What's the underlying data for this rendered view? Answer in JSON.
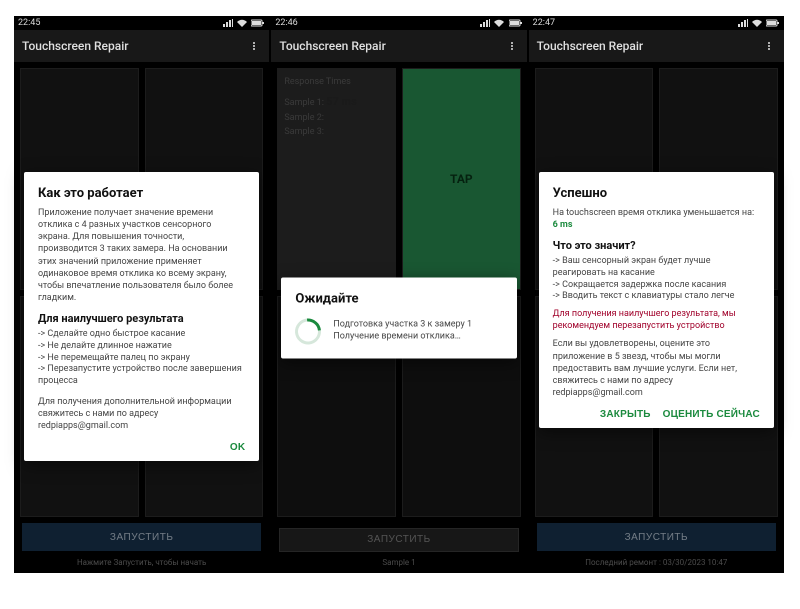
{
  "screens": [
    {
      "status_time": "22:45",
      "appbar_title": "Touchscreen Repair",
      "bottom_button": "ЗАПУСТИТЬ",
      "hint": "Нажмите Запустить, чтобы начать",
      "dialog": {
        "title": "Как это работает",
        "body": "Приложение получает значение времени отклика с 4 разных участков сенсорного экрана. Для повышения точности, производится 3 таких замера. На основании этих значений приложение применяет одинаковое время отклика ко всему экрану, чтобы впечатление пользователя было более гладким.",
        "subtitle": "Для наилучшего результата",
        "tips": [
          "-> Сделайте одно быстрое касание",
          "-> Не делайте длинное нажатие",
          "-> Не перемещайте палец по экрану",
          "-> Перезапустите устройство после завершения процесса"
        ],
        "footer": "Для получения дополнительной информации свяжитесь с нами по адресу redpiapps@gmail.com",
        "ok": "OK"
      }
    },
    {
      "status_time": "22:46",
      "appbar_title": "Touchscreen Repair",
      "result_box": {
        "title": "Response Times",
        "sample1_label": "Sample 1:",
        "sample1_value": "57 ms",
        "sample2": "Sample 2:",
        "sample3": "Sample 3:"
      },
      "tap_label": "TAP",
      "bottom_button": "ЗАПУСТИТЬ",
      "hint": "Sample 1",
      "wait_dialog": {
        "title": "Ожидайте",
        "body": "Подготовка участка 3 к замеру 1\nПолучение времени отклика…"
      }
    },
    {
      "status_time": "22:47",
      "appbar_title": "Touchscreen Repair",
      "bottom_button": "ЗАПУСТИТЬ",
      "hint": "Последний ремонт : 03/30/2023 10:47",
      "dialog": {
        "title": "Успешно",
        "line1_pre": "На touchscreen время отклика уменьшается на:",
        "line1_val": "6 ms",
        "subtitle": "Что это значит?",
        "tips": [
          "-> Ваш сенсорный экран будет лучше реагировать на касание",
          "-> Сокращается задержка после касания",
          "-> Вводить текст с клавиатуры стало легче"
        ],
        "warn": "Для получения наилучшего результата, мы рекомендуем перезапустить устройство",
        "footer": "Если вы удовлетворены, оцените это приложение в 5 звезд, чтобы мы могли предоставить вам лучшие услуги. Если нет, свяжитесь с нами по адресу redpiapps@gmail.com",
        "close": "ЗАКРЫТЬ",
        "rate": "ОЦЕНИТЬ СЕЙЧАС"
      }
    }
  ]
}
